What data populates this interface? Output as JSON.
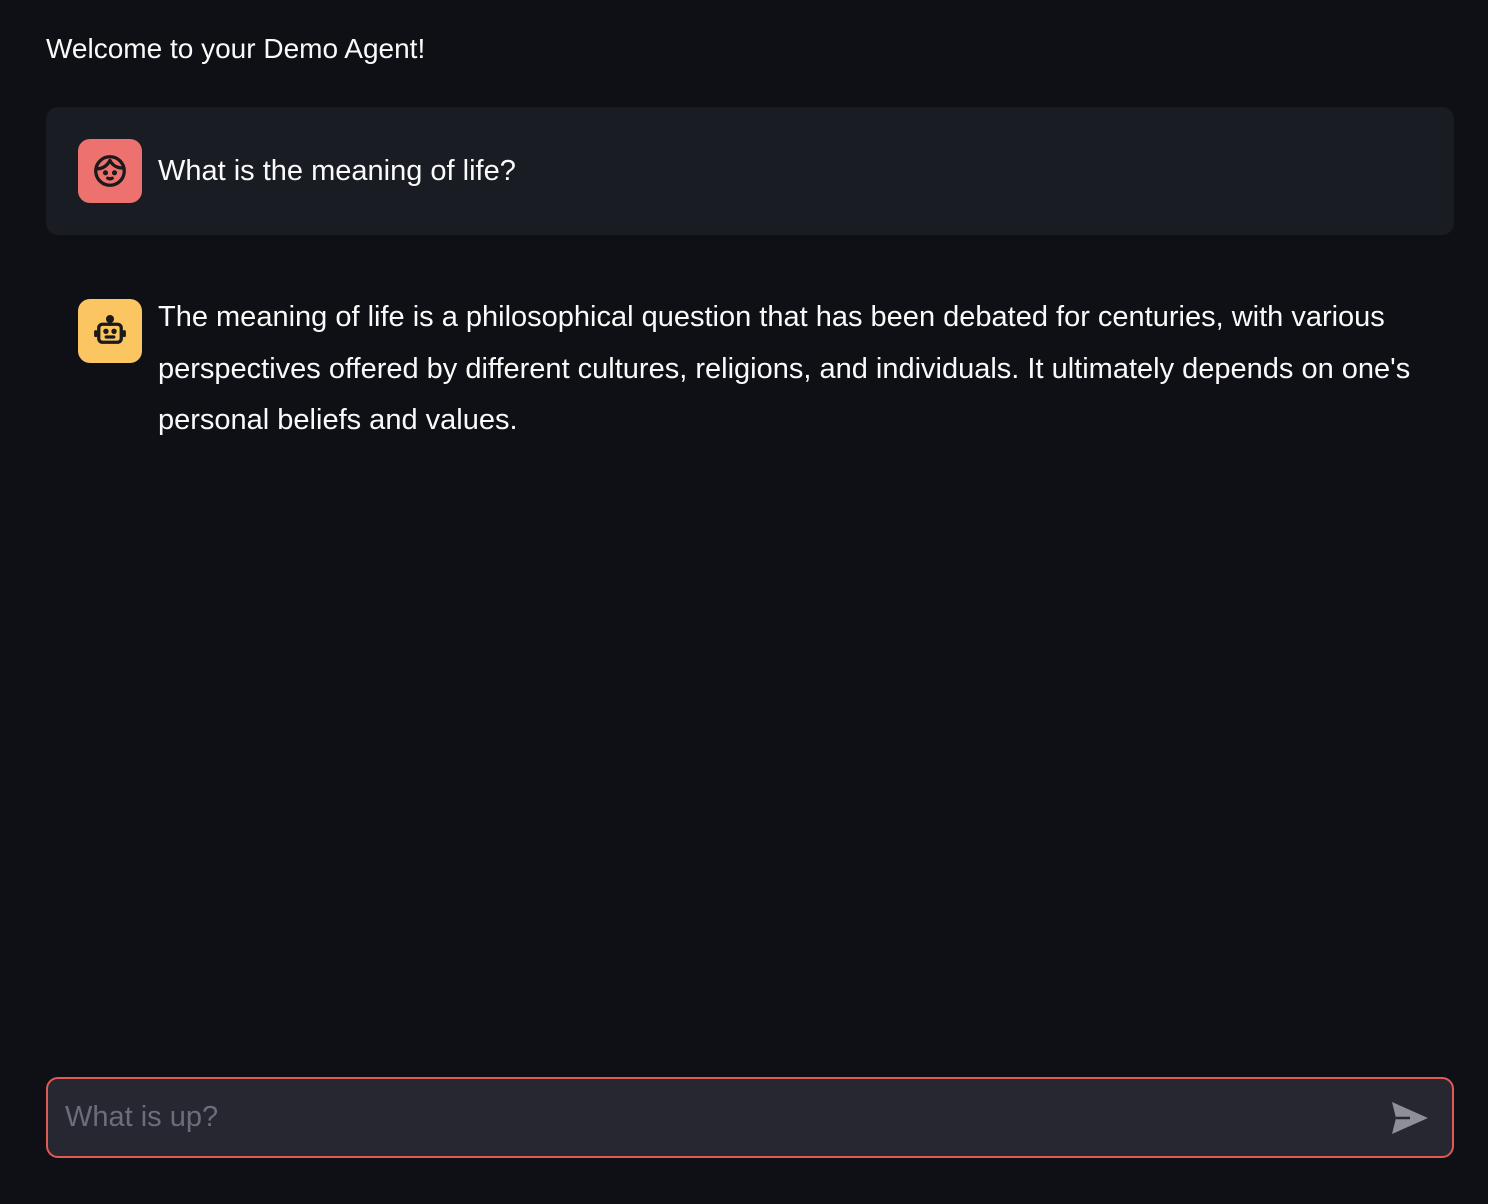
{
  "header": {
    "welcome_text": "Welcome to your Demo Agent!"
  },
  "messages": [
    {
      "role": "user",
      "avatar_icon": "user-face-icon",
      "avatar_color": "#ec716f",
      "text": "What is the meaning of life?"
    },
    {
      "role": "assistant",
      "avatar_icon": "robot-icon",
      "avatar_color": "#fbc661",
      "text": "The meaning of life is a philosophical question that has been debated for centuries, with various perspectives offered by different cultures, religions, and individuals. It ultimately depends on one's personal beliefs and values."
    }
  ],
  "chat_input": {
    "value": "",
    "placeholder": "What is up?",
    "border_color": "#e05a56",
    "send_icon": "send-icon"
  }
}
